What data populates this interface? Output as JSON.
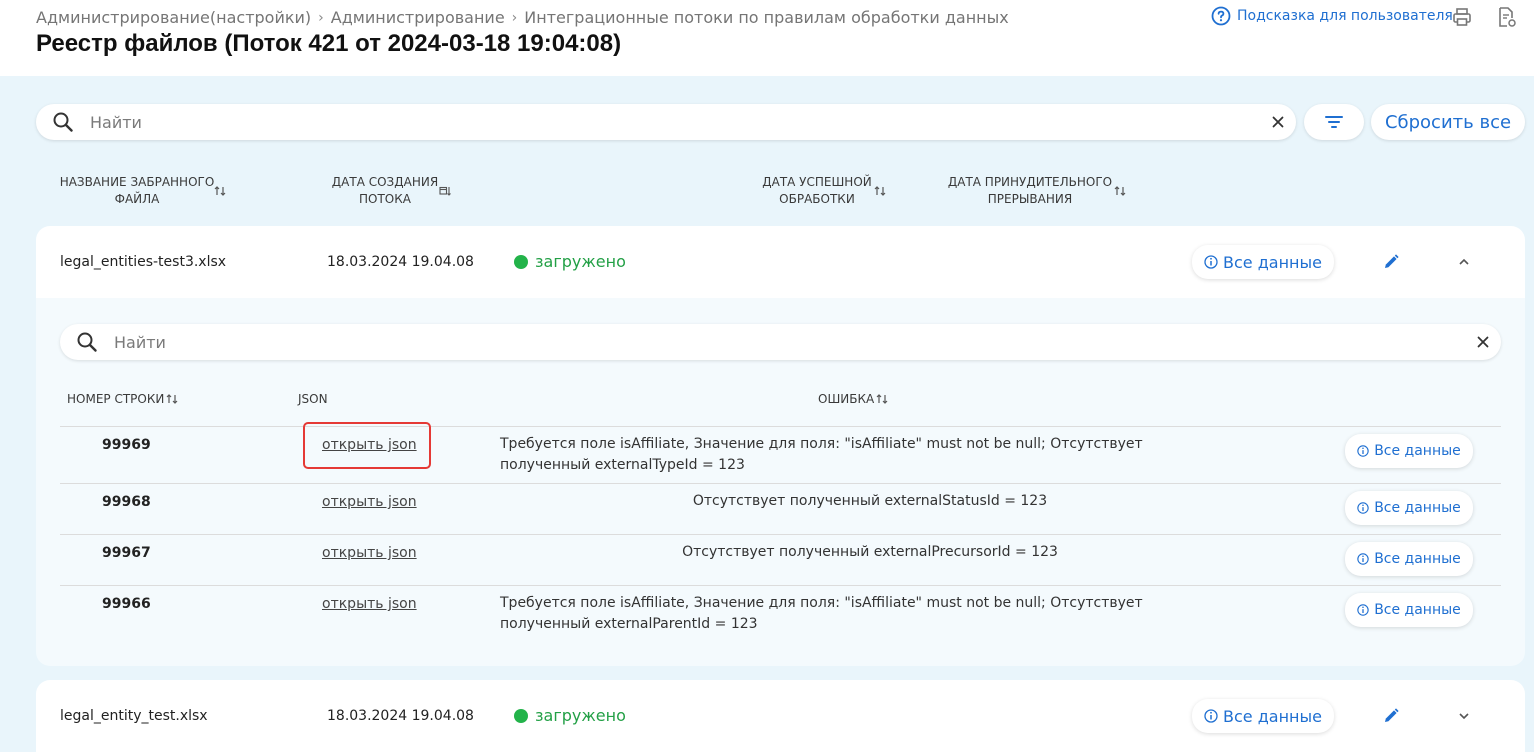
{
  "breadcrumb": {
    "items": [
      "Администрирование(настройки)",
      "Администрирование",
      "Интеграционные потоки по правилам обработки данных"
    ],
    "separator": "›"
  },
  "page_title": "Реестр файлов (Поток 421 от 2024-03-18 19:04:08)",
  "help_link": "Подсказка для пользователя",
  "search": {
    "placeholder": "Найти",
    "value": ""
  },
  "reset_all": "Сбросить все",
  "columns": {
    "file_name": "Название забранного файла",
    "created": "Дата создания потока",
    "success": "Дата успешной обработки",
    "forced": "Дата принудительного прерывания"
  },
  "files": [
    {
      "name": "legal_entities-test3.xlsx",
      "created": "18.03.2024 19.04.08",
      "status": "загружено",
      "all_data": "Все данные",
      "expanded": true
    },
    {
      "name": "legal_entity_test.xlsx",
      "created": "18.03.2024 19.04.08",
      "status": "загружено",
      "all_data": "Все данные",
      "expanded": false
    }
  ],
  "sub_search": {
    "placeholder": "Найти",
    "value": ""
  },
  "sub_columns": {
    "row_number": "Номер строки",
    "json": "JSON",
    "error": "Ошибка"
  },
  "sub_rows": [
    {
      "num": "99969",
      "json_link": "открыть json",
      "error": "Требуется поле isAffiliate, Значение для поля: \"isAffiliate\" must not be null; Отсутствует полученный externalTypeId = 123",
      "all_data": "Все данные"
    },
    {
      "num": "99968",
      "json_link": "открыть json",
      "error": "Отсутствует полученный externalStatusId = 123",
      "all_data": "Все данные"
    },
    {
      "num": "99967",
      "json_link": "открыть json",
      "error": "Отсутствует полученный externalPrecursorId = 123",
      "all_data": "Все данные"
    },
    {
      "num": "99966",
      "json_link": "открыть json",
      "error": "Требуется поле isAffiliate, Значение для поля: \"isAffiliate\" must not be null; Отсутствует полученный externalParentId = 123",
      "all_data": "Все данные"
    }
  ],
  "colors": {
    "accent": "#1f6fd1",
    "status_ok": "#23b34a",
    "highlight": "#e53935",
    "page_bg": "#e9f5fb"
  }
}
